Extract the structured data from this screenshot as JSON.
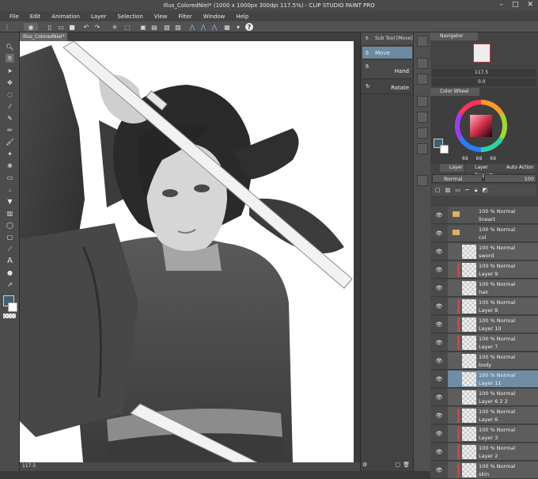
{
  "window": {
    "title": "Illus_ColoredNiel* (1000 x 1000px 300dpi 117.5%) - CLIP STUDIO PAINT PRO"
  },
  "menu": [
    "File",
    "Edit",
    "Animation",
    "Layer",
    "Selection",
    "View",
    "Filter",
    "Window",
    "Help"
  ],
  "document_tab": {
    "label": "Illus_ColoredNiel*"
  },
  "status": {
    "zoom": "117.5"
  },
  "subtool": {
    "header": "Sub Tool [Move]",
    "items": [
      "Move",
      "Hand",
      "Rotate"
    ]
  },
  "navigator": {
    "title": "Navigator",
    "zoom": "117.5",
    "angle": "0.0"
  },
  "color_wheel": {
    "title": "Color Wheel",
    "values": [
      "69",
      "69",
      "69"
    ],
    "accent": "#ff3355"
  },
  "layers_panel": {
    "tabs": [
      "Layer",
      "Layer Property",
      "Auto Action"
    ],
    "blend_mode": "Normal",
    "opacity": "100",
    "rows": [
      {
        "mode": "100 % Normal",
        "name": "lineart",
        "type": "folder",
        "red": false,
        "selected": false
      },
      {
        "mode": "100 % Normal",
        "name": "col",
        "type": "folder",
        "red": false,
        "selected": false
      },
      {
        "mode": "100 % Normal",
        "name": "sword",
        "type": "layer",
        "red": false,
        "selected": false
      },
      {
        "mode": "100 % Normal",
        "name": "Layer 9",
        "type": "layer",
        "red": true,
        "selected": false
      },
      {
        "mode": "100 % Normal",
        "name": "hair",
        "type": "layer",
        "red": false,
        "selected": false
      },
      {
        "mode": "100 % Normal",
        "name": "Layer 8",
        "type": "layer",
        "red": true,
        "selected": false
      },
      {
        "mode": "100 % Normal",
        "name": "Layer 10",
        "type": "layer",
        "red": true,
        "selected": false
      },
      {
        "mode": "100 % Normal",
        "name": "Layer 7",
        "type": "layer",
        "red": true,
        "selected": false
      },
      {
        "mode": "100 % Normal",
        "name": "body",
        "type": "layer",
        "red": false,
        "selected": false
      },
      {
        "mode": "100 % Normal",
        "name": "Layer 11",
        "type": "layer",
        "red": false,
        "selected": true
      },
      {
        "mode": "100 % Normal",
        "name": "Layer 6 2 2",
        "type": "layer",
        "red": false,
        "selected": false
      },
      {
        "mode": "100 % Normal",
        "name": "Layer 6",
        "type": "layer",
        "red": true,
        "selected": false
      },
      {
        "mode": "100 % Normal",
        "name": "Layer 3",
        "type": "layer",
        "red": true,
        "selected": false
      },
      {
        "mode": "100 % Normal",
        "name": "Layer 2",
        "type": "layer",
        "red": true,
        "selected": false
      },
      {
        "mode": "100 % Normal",
        "name": "skin",
        "type": "layer",
        "red": true,
        "selected": false
      }
    ]
  },
  "colors": {
    "selection": "#6f8ea6",
    "layer_marker": "#d04444",
    "folder": "#d9b45a"
  },
  "icons": [
    "move-icon",
    "hand-icon",
    "rotate-icon",
    "eye-icon",
    "folder-icon",
    "brush-icon",
    "eraser-icon",
    "text-icon",
    "undo-icon",
    "redo-icon",
    "save-icon",
    "help-icon"
  ]
}
